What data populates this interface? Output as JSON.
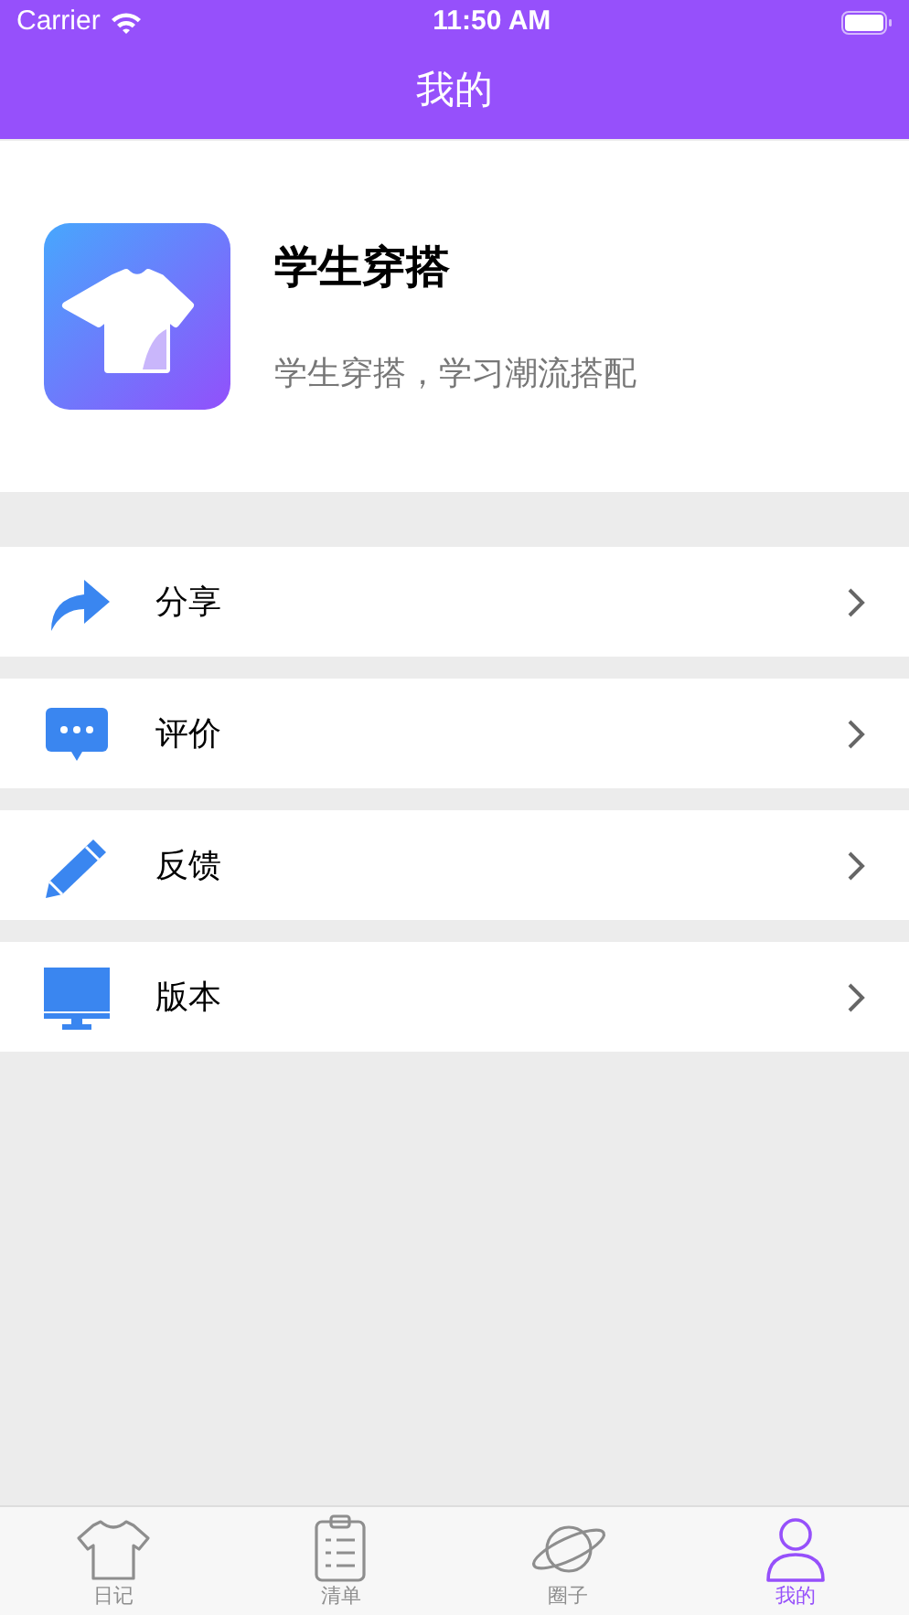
{
  "status_bar": {
    "carrier": "Carrier",
    "time": "11:50 AM"
  },
  "nav_bar": {
    "title": "我的"
  },
  "profile": {
    "name": "学生穿搭",
    "subtitle": "学生穿搭，学习潮流搭配"
  },
  "menu": [
    {
      "kind": "share",
      "label": "分享"
    },
    {
      "kind": "rate",
      "label": "评价"
    },
    {
      "kind": "feedback",
      "label": "反馈"
    },
    {
      "kind": "version",
      "label": "版本"
    }
  ],
  "tab_bar": [
    {
      "kind": "diary",
      "label": "日记",
      "selected": false
    },
    {
      "kind": "list",
      "label": "清单",
      "selected": false
    },
    {
      "kind": "circle",
      "label": "圈子",
      "selected": false
    },
    {
      "kind": "me",
      "label": "我的",
      "selected": true
    }
  ]
}
